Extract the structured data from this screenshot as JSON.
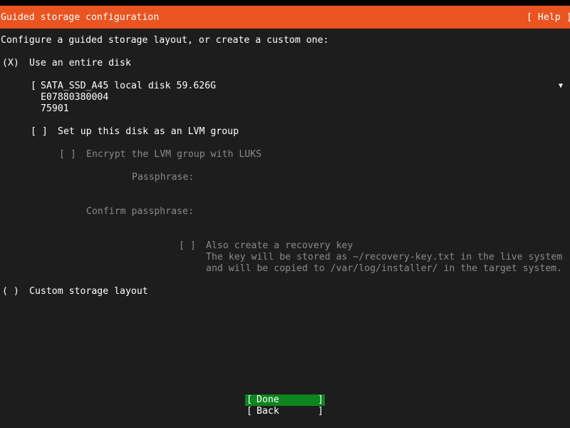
{
  "header": {
    "title": "Guided storage configuration",
    "help_button": "[ Help ]"
  },
  "intro_text": "Configure a guided storage layout, or create a custom one:",
  "option_entire_disk": {
    "radio": "(X)",
    "label": "Use an entire disk"
  },
  "disk_select": {
    "bracket": "[",
    "line1": "SATA_SSD_A45 local disk 59.626G",
    "line2": "E07880380004",
    "line3": "75901",
    "dropdown_icon": "▼"
  },
  "lvm_option": {
    "checkbox": "[ ]",
    "label": "Set up this disk as an LVM group"
  },
  "luks_option": {
    "checkbox": "[ ]",
    "label": "Encrypt the LVM group with LUKS"
  },
  "passphrase": {
    "label": "Passphrase:",
    "value": ""
  },
  "confirm_passphrase": {
    "label": "Confirm passphrase:",
    "value": ""
  },
  "recovery_key": {
    "checkbox": "[ ]",
    "label": "Also create a recovery key",
    "desc_line1": "The key will be stored as ~/recovery-key.txt in the live system",
    "desc_line2": "and will be copied to /var/log/installer/ in the target system."
  },
  "option_custom": {
    "radio": "( )",
    "label": "Custom storage layout"
  },
  "buttons": {
    "done": "Done",
    "back": "Back"
  },
  "colors": {
    "title_bar": "#e95420",
    "background": "#1d1d1d",
    "focused_button": "#0e8420",
    "disabled_text": "#8a8a8a"
  }
}
